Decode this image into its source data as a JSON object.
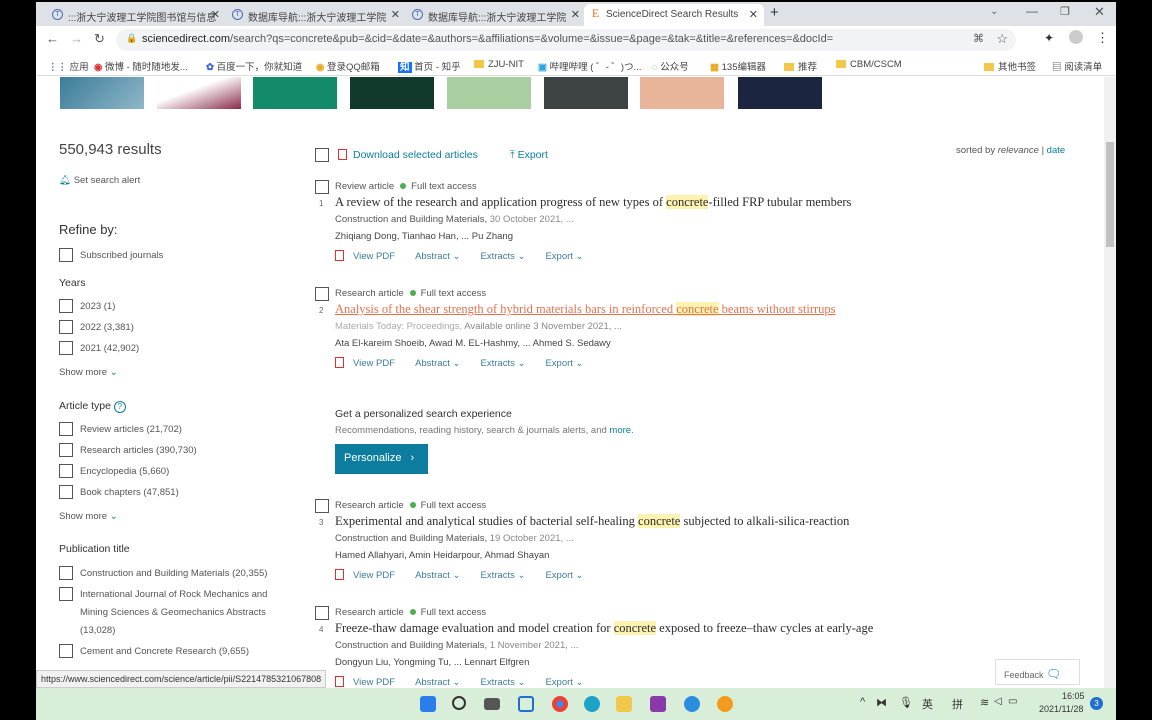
{
  "browser": {
    "tabs": [
      {
        "label": ":::浙大宁波理工学院图书馆与信息"
      },
      {
        "label": "数据库导航:::浙大宁波理工学院"
      },
      {
        "label": "数据库导航:::浙大宁波理工学院"
      },
      {
        "label": "ScienceDirect Search Results"
      }
    ],
    "new_tab": "+",
    "url_host": "sciencedirect.com",
    "url_rest": "/search?qs=concrete&pub=&cid=&date=&authors=&affiliations=&volume=&issue=&page=&tak=&title=&references=&docId=",
    "bookmarks": [
      "应用",
      "微博 - 随时随地发...",
      "百度一下，你就知道",
      "登录QQ邮箱",
      "首页 - 知乎",
      "ZJU-NIT",
      "哔哩哔哩 ( ゜- ゜)つ...",
      "公众号",
      "135编辑器",
      "推荐",
      "CBM/CSCM",
      "其他书签",
      "阅读清单"
    ],
    "status_url": "https://www.sciencedirect.com/science/article/pii/S2214785321067808"
  },
  "results": {
    "count": "550,943 results",
    "set_alert": "Set search alert",
    "download": "Download selected articles",
    "export": "Export",
    "sorted_by": "sorted by",
    "sort_relevance": "relevance",
    "sort_sep": "|",
    "sort_date": "date"
  },
  "refine": {
    "title": "Refine by:",
    "subscribed": "Subscribed journals",
    "years_title": "Years",
    "years": [
      "2023 (1)",
      "2022 (3,381)",
      "2021 (42,902)"
    ],
    "show_more": "Show more",
    "type_title": "Article type",
    "types": [
      "Review articles (21,702)",
      "Research articles (390,730)",
      "Encyclopedia (5,660)",
      "Book chapters (47,851)"
    ],
    "pub_title": "Publication title",
    "pubs": [
      "Construction and Building Materials (20,355)",
      "International Journal of Rock Mechanics and",
      "Mining Sciences & Geomechanics Abstracts",
      "(13,028)",
      "Cement and Concrete Research (9,655)"
    ]
  },
  "articles": [
    {
      "type": "Review article",
      "access": "Full text access",
      "num": "1",
      "pre": "A review of the research and application progress of new types of ",
      "hl": "concrete",
      "post": "-filled FRP tubular members",
      "journal": "Construction and Building Materials,",
      "date": "30 October 2021, ...",
      "authors": "Zhiqiang Dong, Tianhao Han, ... Pu Zhang"
    },
    {
      "type": "Research article",
      "access": "Full text access",
      "num": "2",
      "pre": "Analysis of the shear strength of hybrid materials bars in reinforced ",
      "hl": "concrete",
      "post": " beams without stirrups",
      "journal": "Materials Today: Proceedings,",
      "date": "Available online 3 November 2021, ...",
      "authors": "Ata El-kareim Shoeib, Awad M. EL-Hashmy, ... Ahmed S. Sedawy"
    },
    {
      "type": "Research article",
      "access": "Full text access",
      "num": "3",
      "pre": "Experimental and analytical studies of bacterial self-healing ",
      "hl": "concrete",
      "post": " subjected to alkali-silica-reaction",
      "journal": "Construction and Building Materials,",
      "date": "19 October 2021, ...",
      "authors": "Hamed Allahyari, Amin Heidarpour, Ahmad Shayan"
    },
    {
      "type": "Research article",
      "access": "Full text access",
      "num": "4",
      "pre": "Freeze-thaw damage evaluation and model creation for ",
      "hl": "concrete",
      "post": " exposed to freeze–thaw cycles at early-age",
      "journal": "Construction and Building Materials,",
      "date": "1 November 2021, ...",
      "authors": "Dongyun Liu, Yongming Tu, ... Lennart Elfgren"
    }
  ],
  "actions": {
    "view_pdf": "View PDF",
    "abstract": "Abstract",
    "extracts": "Extracts",
    "export": "Export"
  },
  "personalize": {
    "title": "Get a personalized search experience",
    "desc": "Recommendations, reading history, search & journals alerts, and ",
    "more": "more.",
    "button": "Personalize"
  },
  "feedback": "Feedback",
  "taskbar": {
    "ime1": "英",
    "ime2": "拼",
    "time": "16:05",
    "date": "2021/11/28",
    "badge": "3"
  },
  "colors": {
    "accent": "#0c7d9e",
    "highlight": "#fdf2b0",
    "visited": "#e8704c",
    "taskbar": "#d9eed8"
  }
}
